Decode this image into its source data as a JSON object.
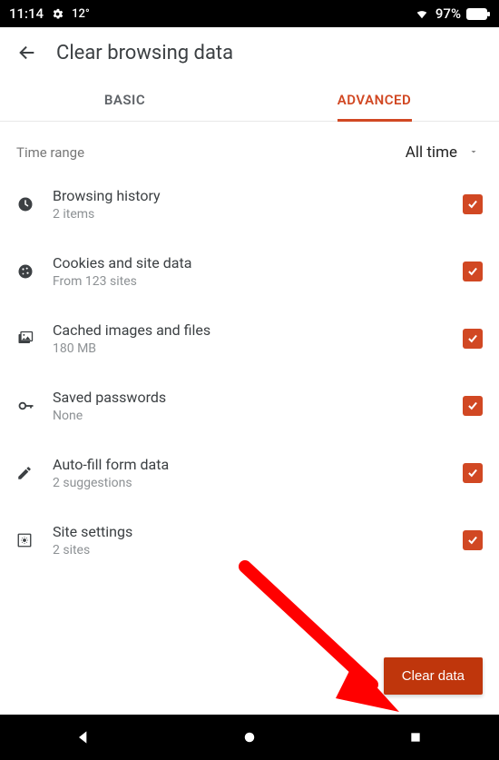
{
  "statusbar": {
    "time": "11:14",
    "temp": "12°",
    "battery_pct": "97%"
  },
  "header": {
    "title": "Clear browsing data"
  },
  "tabs": {
    "basic": "BASIC",
    "advanced": "ADVANCED",
    "active": "advanced"
  },
  "timerange": {
    "label": "Time range",
    "value": "All time"
  },
  "items": [
    {
      "title": "Browsing history",
      "sub": "2 items"
    },
    {
      "title": "Cookies and site data",
      "sub": "From 123 sites"
    },
    {
      "title": "Cached images and files",
      "sub": "180 MB"
    },
    {
      "title": "Saved passwords",
      "sub": "None"
    },
    {
      "title": "Auto-fill form data",
      "sub": "2 suggestions"
    },
    {
      "title": "Site settings",
      "sub": "2 sites"
    }
  ],
  "primary_button": "Clear data",
  "colors": {
    "accent": "#d14823",
    "button": "#bf360c"
  }
}
